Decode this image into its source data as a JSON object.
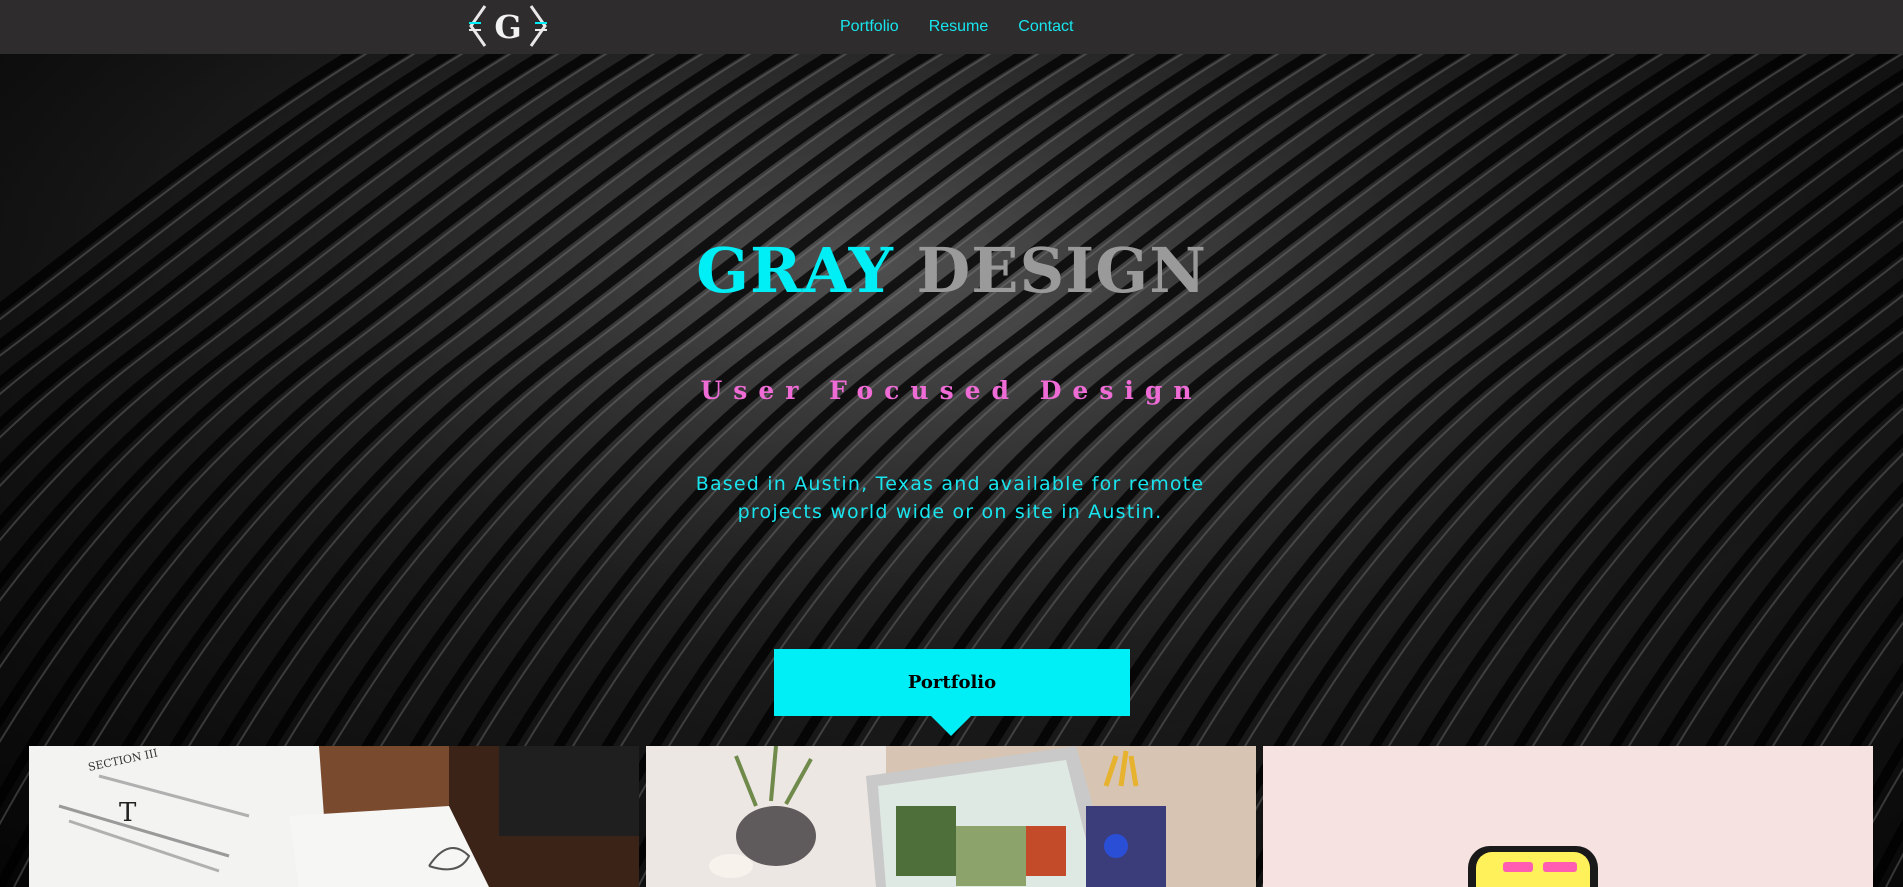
{
  "header": {
    "logo_alt": "G",
    "nav": [
      "Portfolio",
      "Resume",
      "Contact"
    ]
  },
  "hero": {
    "title_word1": "GRAY",
    "title_word2": "DESIGN",
    "tagline": "User Focused Design",
    "subtext": "Based in Austin, Texas and available for remote projects world wide or on site in Austin.",
    "cta_label": "Portfolio"
  },
  "colors": {
    "accent_cyan": "#00eef5",
    "accent_pink": "#ef6bd6",
    "header_bg": "#2e2c2d"
  },
  "cards": [
    {
      "name": "book-mockup",
      "icon": "open-book-image"
    },
    {
      "name": "laptop-mockup",
      "icon": "laptop-website-image"
    },
    {
      "name": "phone-mockup",
      "icon": "phone-app-image"
    }
  ]
}
